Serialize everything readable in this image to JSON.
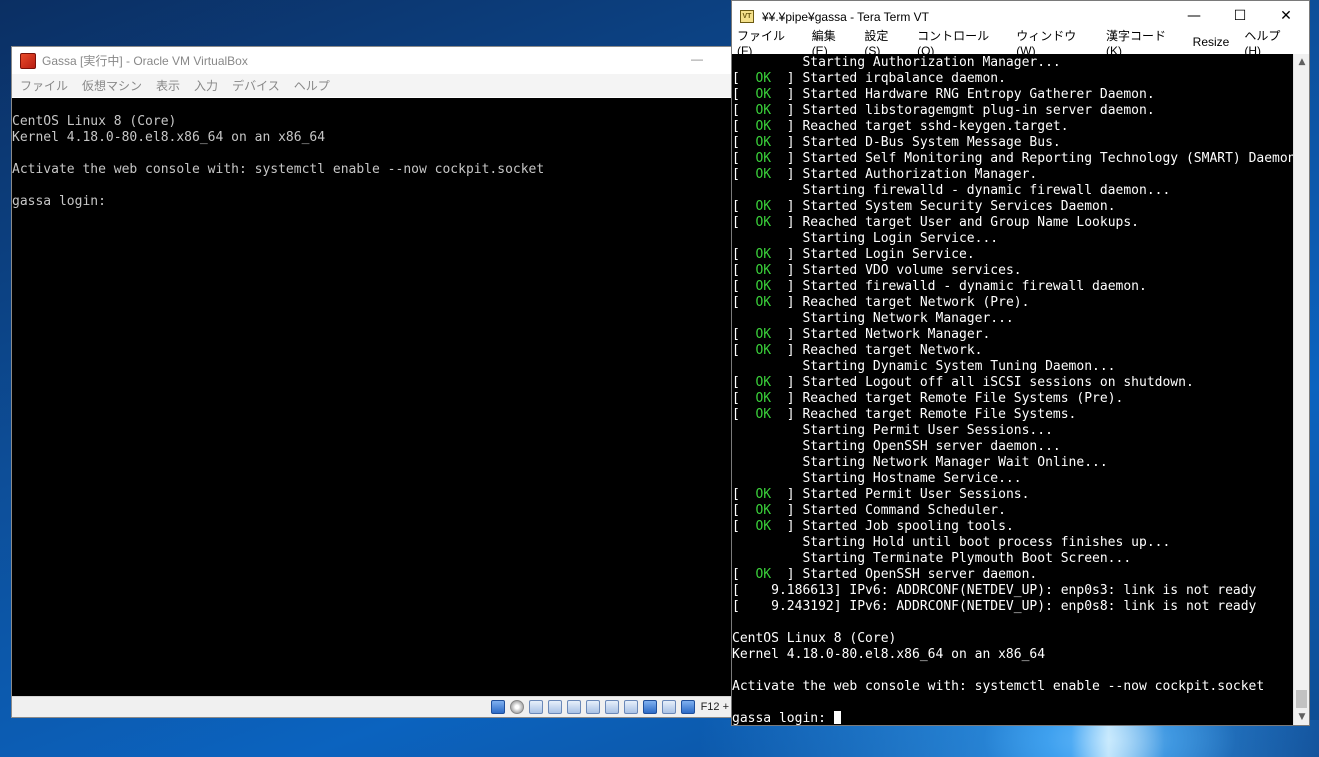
{
  "vbox": {
    "title": "Gassa [実行中] - Oracle VM VirtualBox",
    "minimize_glyph": "—",
    "menu": [
      "ファイル",
      "仮想マシン",
      "表示",
      "入力",
      "デバイス",
      "ヘルプ"
    ],
    "console": [
      "CentOS Linux 8 (Core)",
      "Kernel 4.18.0-80.el8.x86_64 on an x86_64",
      "",
      "Activate the web console with: systemctl enable --now cockpit.socket",
      "",
      "gassa login:"
    ],
    "host_key": "F12 +",
    "status_icons": [
      "harddisk-icon",
      "optical-drive-icon",
      "audio-icon",
      "network-icon",
      "usb-icon",
      "shared-folder-icon",
      "display-icon",
      "video-capture-icon",
      "virtualization-icon",
      "mouse-integration-icon",
      "keyboard-capture-icon"
    ]
  },
  "teraterm": {
    "title": "¥¥.¥pipe¥gassa - Tera Term VT",
    "icon_text": "VT",
    "controls": {
      "minimize": "—",
      "maximize": "☐",
      "close": "✕"
    },
    "menu": [
      "ファイル(F)",
      "編集(E)",
      "設定(S)",
      "コントロール(O)",
      "ウィンドウ(W)",
      "漢字コード(K)",
      "Resize",
      "ヘルプ(H)"
    ],
    "ok_text": "OK",
    "lines": [
      {
        "status": "",
        "text": "         Starting Authorization Manager..."
      },
      {
        "status": "ok",
        "text": "Started irqbalance daemon."
      },
      {
        "status": "ok",
        "text": "Started Hardware RNG Entropy Gatherer Daemon."
      },
      {
        "status": "ok",
        "text": "Started libstoragemgmt plug-in server daemon."
      },
      {
        "status": "ok",
        "text": "Reached target sshd-keygen.target."
      },
      {
        "status": "ok",
        "text": "Started D-Bus System Message Bus."
      },
      {
        "status": "ok",
        "text": "Started Self Monitoring and Reporting Technology (SMART) Daemon."
      },
      {
        "status": "ok",
        "text": "Started Authorization Manager."
      },
      {
        "status": "",
        "text": "         Starting firewalld - dynamic firewall daemon..."
      },
      {
        "status": "ok",
        "text": "Started System Security Services Daemon."
      },
      {
        "status": "ok",
        "text": "Reached target User and Group Name Lookups."
      },
      {
        "status": "",
        "text": "         Starting Login Service..."
      },
      {
        "status": "ok",
        "text": "Started Login Service."
      },
      {
        "status": "ok",
        "text": "Started VDO volume services."
      },
      {
        "status": "ok",
        "text": "Started firewalld - dynamic firewall daemon."
      },
      {
        "status": "ok",
        "text": "Reached target Network (Pre)."
      },
      {
        "status": "",
        "text": "         Starting Network Manager..."
      },
      {
        "status": "ok",
        "text": "Started Network Manager."
      },
      {
        "status": "ok",
        "text": "Reached target Network."
      },
      {
        "status": "",
        "text": "         Starting Dynamic System Tuning Daemon..."
      },
      {
        "status": "ok",
        "text": "Started Logout off all iSCSI sessions on shutdown."
      },
      {
        "status": "ok",
        "text": "Reached target Remote File Systems (Pre)."
      },
      {
        "status": "ok",
        "text": "Reached target Remote File Systems."
      },
      {
        "status": "",
        "text": "         Starting Permit User Sessions..."
      },
      {
        "status": "",
        "text": "         Starting OpenSSH server daemon..."
      },
      {
        "status": "",
        "text": "         Starting Network Manager Wait Online..."
      },
      {
        "status": "",
        "text": "         Starting Hostname Service..."
      },
      {
        "status": "ok",
        "text": "Started Permit User Sessions."
      },
      {
        "status": "ok",
        "text": "Started Command Scheduler."
      },
      {
        "status": "ok",
        "text": "Started Job spooling tools."
      },
      {
        "status": "",
        "text": "         Starting Hold until boot process finishes up..."
      },
      {
        "status": "",
        "text": "         Starting Terminate Plymouth Boot Screen..."
      },
      {
        "status": "ok",
        "text": "Started OpenSSH server daemon."
      },
      {
        "status": "",
        "text": "[    9.186613] IPv6: ADDRCONF(NETDEV_UP): enp0s3: link is not ready"
      },
      {
        "status": "",
        "text": "[    9.243192] IPv6: ADDRCONF(NETDEV_UP): enp0s8: link is not ready"
      },
      {
        "status": "",
        "text": ""
      },
      {
        "status": "",
        "text": "CentOS Linux 8 (Core)"
      },
      {
        "status": "",
        "text": "Kernel 4.18.0-80.el8.x86_64 on an x86_64"
      },
      {
        "status": "",
        "text": ""
      },
      {
        "status": "",
        "text": "Activate the web console with: systemctl enable --now cockpit.socket"
      },
      {
        "status": "",
        "text": ""
      },
      {
        "status": "prompt",
        "text": "gassa login: "
      }
    ]
  }
}
